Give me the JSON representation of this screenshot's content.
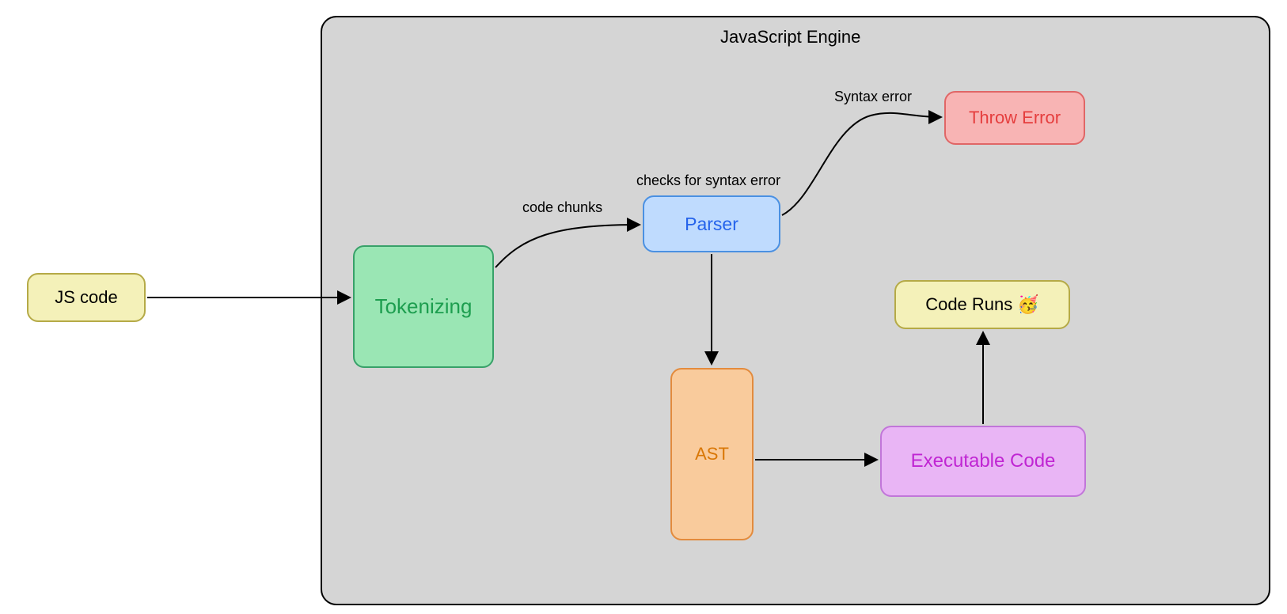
{
  "diagram": {
    "container_title": "JavaScript Engine",
    "nodes": {
      "js_code": {
        "label": "JS code"
      },
      "tokenizing": {
        "label": "Tokenizing"
      },
      "parser": {
        "label": "Parser",
        "annotation": "checks for syntax error"
      },
      "throw_error": {
        "label": "Throw Error"
      },
      "ast": {
        "label": "AST"
      },
      "executable": {
        "label": "Executable Code"
      },
      "code_runs": {
        "label": "Code Runs 🥳"
      }
    },
    "edges": {
      "code_chunks": {
        "label": "code chunks"
      },
      "syntax_error": {
        "label": "Syntax error"
      }
    }
  },
  "colors": {
    "yellow_fill": "#f4f1b9",
    "yellow_stroke": "#b5aa47",
    "green_fill": "#9ae6b4",
    "green_stroke": "#38a169",
    "green_text": "#1d9e4f",
    "blue_fill": "#bfdbfe",
    "blue_stroke": "#4a90e2",
    "blue_text": "#2563eb",
    "red_fill": "#f8b4b4",
    "red_stroke": "#e06666",
    "red_text": "#e53e3e",
    "orange_fill": "#f9cb9c",
    "orange_stroke": "#e38b3d",
    "orange_text": "#d97706",
    "purple_fill": "#e9b5f5",
    "purple_stroke": "#c176d9",
    "purple_text": "#c026d3",
    "container_fill": "#d5d5d5"
  }
}
